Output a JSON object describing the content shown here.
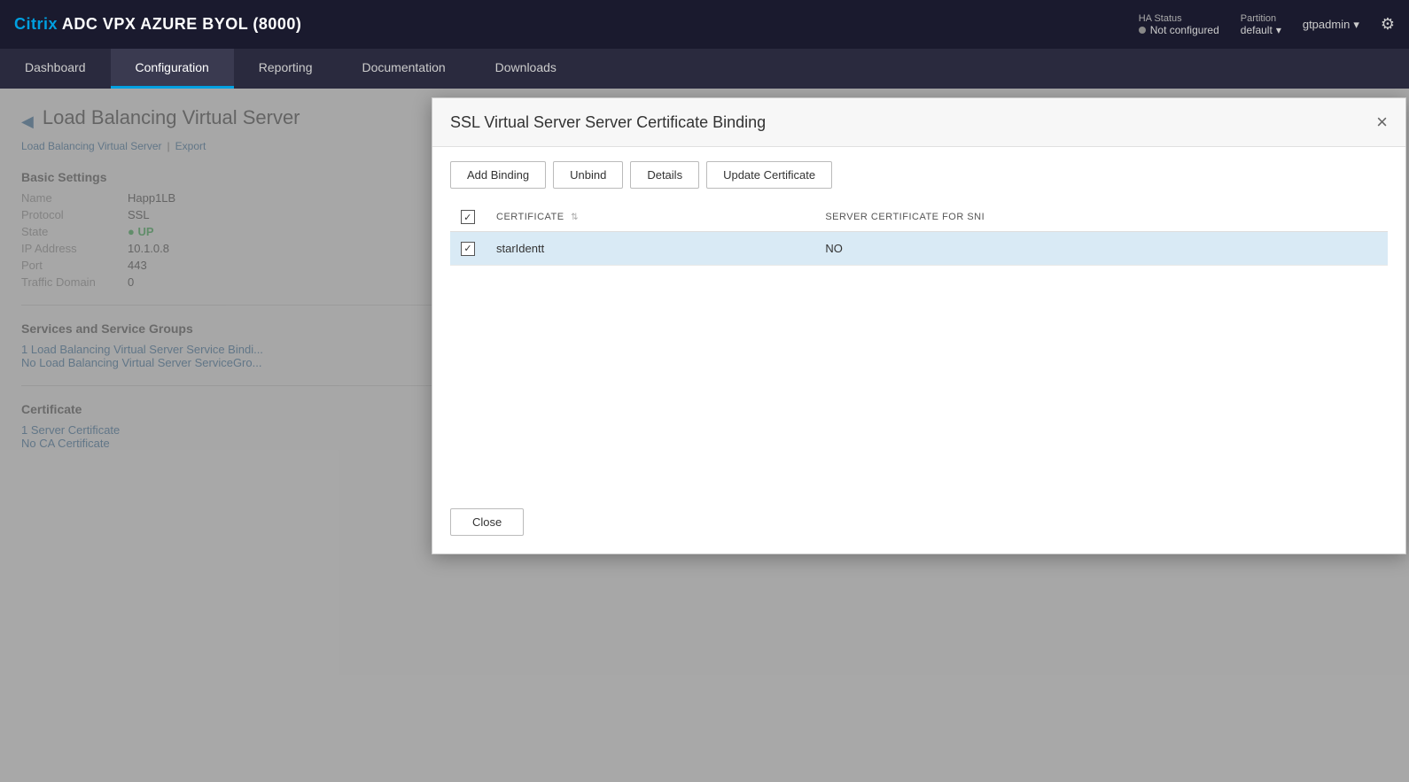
{
  "topbar": {
    "brand": "Citrix ADC VPX AZURE BYOL (8000)",
    "brand_citrix": "Citrix",
    "ha_label": "HA Status",
    "ha_value": "Not configured",
    "partition_label": "Partition",
    "partition_value": "default",
    "user": "gtpadmin"
  },
  "navbar": {
    "tabs": [
      {
        "id": "dashboard",
        "label": "Dashboard",
        "active": false
      },
      {
        "id": "configuration",
        "label": "Configuration",
        "active": true
      },
      {
        "id": "reporting",
        "label": "Reporting",
        "active": false
      },
      {
        "id": "documentation",
        "label": "Documentation",
        "active": false
      },
      {
        "id": "downloads",
        "label": "Downloads",
        "active": false
      }
    ]
  },
  "background": {
    "page_title": "Load Balancing Virtual Server",
    "breadcrumb_link": "Load Balancing Virtual Server",
    "breadcrumb_export": "Export",
    "basic_settings": "Basic Settings",
    "fields": [
      {
        "label": "Name",
        "value": "Happ1LB"
      },
      {
        "label": "Protocol",
        "value": "SSL"
      },
      {
        "label": "State",
        "value": "UP",
        "status": "up"
      },
      {
        "label": "IP Address",
        "value": "10.1.0.8"
      },
      {
        "label": "Port",
        "value": "443"
      },
      {
        "label": "Traffic Domain",
        "value": "0"
      }
    ],
    "services_section": "Services and Service Groups",
    "service_binding_link": "1 Load Balancing Virtual Server Service Bindi...",
    "service_group_link": "No Load Balancing Virtual Server ServiceGro...",
    "cert_section": "Certificate",
    "server_cert_link": "1 Server Certificate",
    "ca_cert_link": "No CA Certificate"
  },
  "modal": {
    "title": "SSL Virtual Server Server Certificate Binding",
    "close_label": "×",
    "toolbar": {
      "add_binding": "Add Binding",
      "unbind": "Unbind",
      "details": "Details",
      "update_certificate": "Update Certificate"
    },
    "table": {
      "col_certificate": "CERTIFICATE",
      "col_sni": "SERVER CERTIFICATE FOR SNI",
      "rows": [
        {
          "checked": true,
          "certificate": "starIdentt",
          "sni": "NO"
        }
      ]
    },
    "close_button": "Close"
  }
}
